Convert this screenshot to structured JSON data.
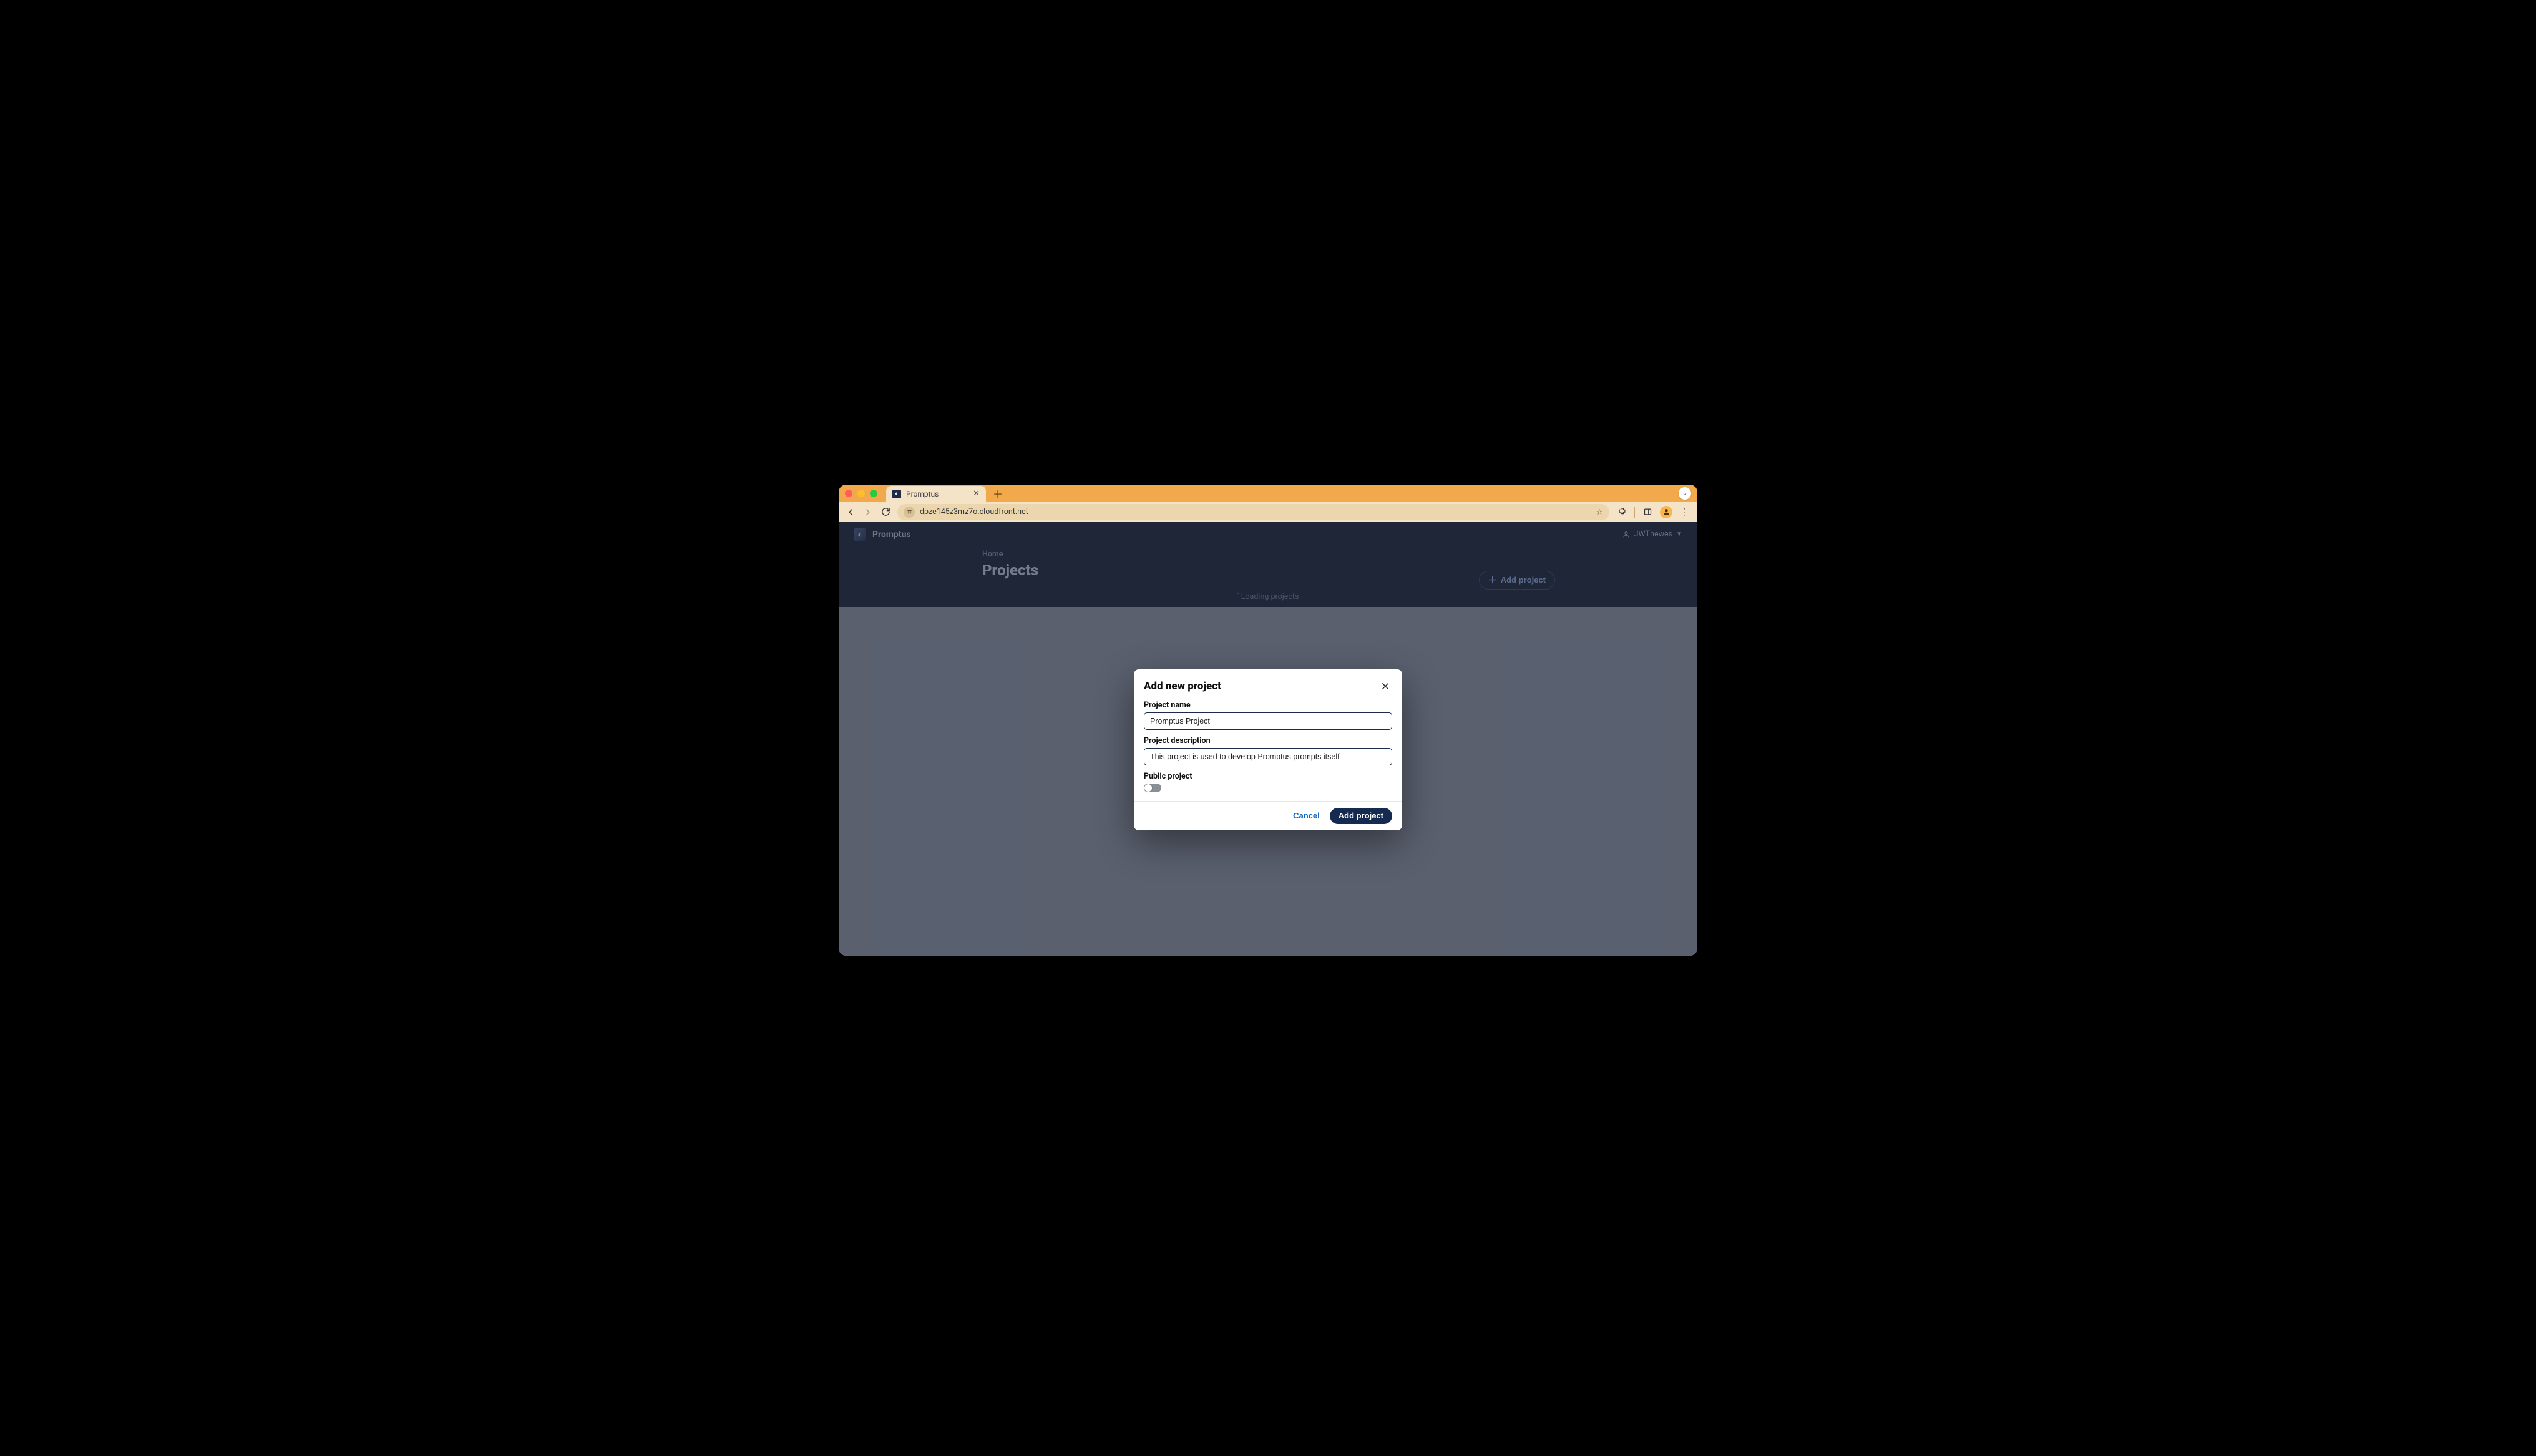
{
  "browser": {
    "tab_title": "Promptus",
    "url": "dpze145z3mz7o.cloudfront.net"
  },
  "app": {
    "brand_name": "Promptus",
    "user_name": "JWThewes",
    "breadcrumb": "Home",
    "page_title": "Projects",
    "add_project_label": "Add project",
    "loading_text": "Loading projects"
  },
  "dialog": {
    "title": "Add new project",
    "name_label": "Project name",
    "name_value": "Promptus Project",
    "desc_label": "Project description",
    "desc_value": "This project is used to develop Promptus prompts itself",
    "public_label": "Public project",
    "public_on": false,
    "cancel_label": "Cancel",
    "submit_label": "Add project"
  }
}
